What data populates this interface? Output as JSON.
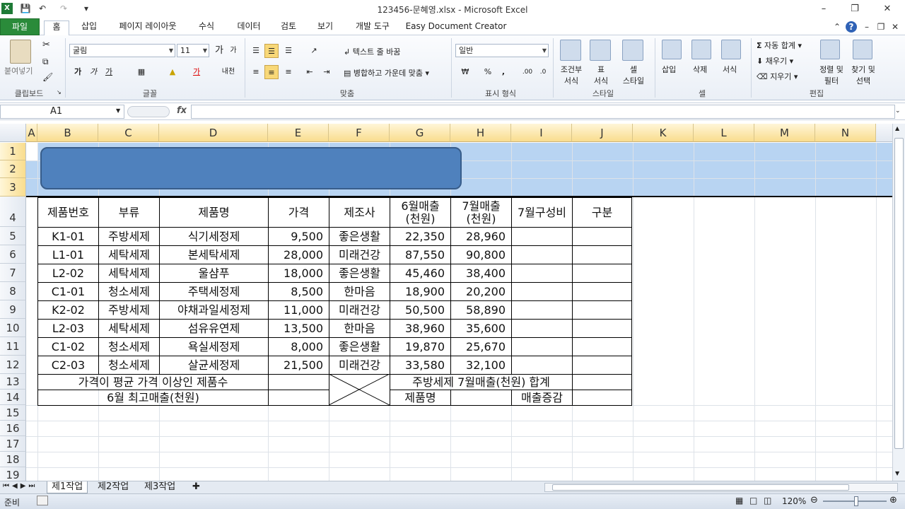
{
  "window": {
    "title": "123456-문혜영.xlsx  -  Microsoft Excel"
  },
  "ribbon_tabs": [
    "파일",
    "홈",
    "삽입",
    "페이지 레이아웃",
    "수식",
    "데이터",
    "검토",
    "보기",
    "개발 도구",
    "Easy Document Creator"
  ],
  "ribbon": {
    "clipboard": {
      "paste": "붙여넣기",
      "label": "클립보드"
    },
    "font": {
      "name": "굴림",
      "size": "11",
      "grow": "가",
      "shrink": "가",
      "bold": "가",
      "italic": "가",
      "underline": "가",
      "label": "글꼴",
      "phonetic": "내천"
    },
    "align": {
      "wrap": "텍스트 줄 바꿈",
      "merge": "병합하고 가운데 맞춤",
      "label": "맞춤"
    },
    "number": {
      "format": "일반",
      "percent": "%",
      "comma": ",",
      "label": "표시 형식"
    },
    "styles": {
      "cond1": "조건부",
      "cond2": "서식",
      "table1": "표",
      "table2": "서식",
      "cell1": "셀",
      "cell2": "스타일",
      "label": "스타일"
    },
    "cells": {
      "insert": "삽입",
      "delete": "삭제",
      "format": "서식",
      "label": "셀"
    },
    "editing": {
      "autosum": "자동 합계",
      "fill": "채우기",
      "clear": "지우기",
      "sort1": "정렬 및",
      "sort2": "필터",
      "find1": "찾기 및",
      "find2": "선택",
      "label": "편집"
    }
  },
  "formula_bar": {
    "name_box": "A1",
    "fx": "fx",
    "value": ""
  },
  "columns": [
    "A",
    "B",
    "C",
    "D",
    "E",
    "F",
    "G",
    "H",
    "I",
    "J",
    "K",
    "L",
    "M",
    "N"
  ],
  "rows": [
    "1",
    "2",
    "3",
    "4",
    "5",
    "6",
    "7",
    "8",
    "9",
    "10",
    "11",
    "12",
    "13",
    "14",
    "15",
    "16",
    "17",
    "18",
    "19"
  ],
  "table": {
    "headers": {
      "id": "제품번호",
      "cat": "부류",
      "name": "제품명",
      "price": "가격",
      "maker": "제조사",
      "jun1": "6월매출",
      "jun2": "(천원)",
      "jul1": "7월매출",
      "jul2": "(천원)",
      "ratio": "7월구성비",
      "div": "구분"
    },
    "rows": [
      [
        "K1-01",
        "주방세제",
        "식기세정제",
        "9,500",
        "좋은생활",
        "22,350",
        "28,960"
      ],
      [
        "L1-01",
        "세탁세제",
        "본세탁세제",
        "28,000",
        "미래건강",
        "87,550",
        "90,800"
      ],
      [
        "L2-02",
        "세탁세제",
        "울샴푸",
        "18,000",
        "좋은생활",
        "45,460",
        "38,400"
      ],
      [
        "C1-01",
        "청소세제",
        "주택세정제",
        "8,500",
        "한마음",
        "18,900",
        "20,200"
      ],
      [
        "K2-02",
        "주방세제",
        "야채과일세정제",
        "11,000",
        "미래건강",
        "50,500",
        "58,890"
      ],
      [
        "L2-03",
        "세탁세제",
        "섬유유연제",
        "13,500",
        "한마음",
        "38,960",
        "35,600"
      ],
      [
        "C1-02",
        "청소세제",
        "욕실세정제",
        "8,000",
        "좋은생활",
        "19,870",
        "25,670"
      ],
      [
        "C2-03",
        "청소세제",
        "살균세정제",
        "21,500",
        "미래건강",
        "33,580",
        "32,100"
      ]
    ],
    "summary": {
      "avg_count": "가격이 평균 가격 이상인 제품수",
      "max_june": "6월 최고매출(천원)",
      "kitchen_sum": "주방세제 7월매출(천원) 합계",
      "prod_name": "제품명",
      "increase": "매출증감"
    }
  },
  "sheets": [
    "제1작업",
    "제2작업",
    "제3작업"
  ],
  "status": {
    "mode": "준비",
    "zoom": "120%"
  }
}
